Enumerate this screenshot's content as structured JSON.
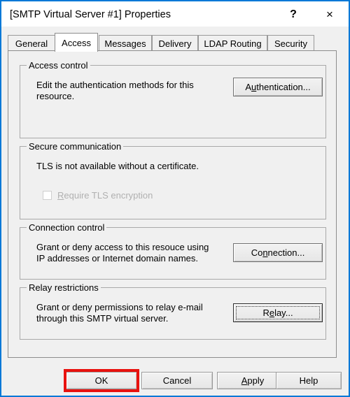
{
  "window": {
    "title": "[SMTP Virtual Server #1] Properties",
    "accent_color": "#0078d7",
    "face_color": "#f0f0f0",
    "help_button": "?",
    "close_button": "×"
  },
  "tabs": [
    {
      "label": "General",
      "active": false
    },
    {
      "label": "Access",
      "active": true
    },
    {
      "label": "Messages",
      "active": false
    },
    {
      "label": "Delivery",
      "active": false
    },
    {
      "label": "LDAP Routing",
      "active": false
    },
    {
      "label": "Security",
      "active": false
    }
  ],
  "groups": {
    "access_control": {
      "title": "Access control",
      "description": "Edit the authentication methods for this\nresource.",
      "button": {
        "label_pre": "A",
        "label_mnemonic": "u",
        "label_post": "thentication...",
        "full_label": "Authentication..."
      }
    },
    "secure_communication": {
      "title": "Secure communication",
      "description": "TLS is not available without a certificate.",
      "checkbox": {
        "label_pre": "",
        "label_mnemonic": "R",
        "label_post": "equire TLS encryption",
        "full_label": "Require TLS encryption",
        "checked": false,
        "enabled": false
      }
    },
    "connection_control": {
      "title": "Connection control",
      "description": "Grant or deny access to this resouce using\nIP addresses or Internet domain names.",
      "button": {
        "label_pre": "Co",
        "label_mnemonic": "n",
        "label_post": "nection...",
        "full_label": "Connection..."
      }
    },
    "relay_restrictions": {
      "title": "Relay restrictions",
      "description": "Grant or deny permissions to relay e-mail\nthrough this SMTP virtual server.",
      "button": {
        "label_pre": "R",
        "label_mnemonic": "e",
        "label_post": "lay...",
        "full_label": "Relay...",
        "focused": true
      }
    }
  },
  "footer": {
    "ok": {
      "label": "OK",
      "highlighted": true
    },
    "cancel": {
      "label": "Cancel"
    },
    "apply": {
      "label_pre": "",
      "label_mnemonic": "A",
      "label_post": "pply",
      "full_label": "Apply"
    },
    "help": {
      "label": "Help"
    }
  },
  "annotation": {
    "color": "#e8120f",
    "target": "OK"
  }
}
